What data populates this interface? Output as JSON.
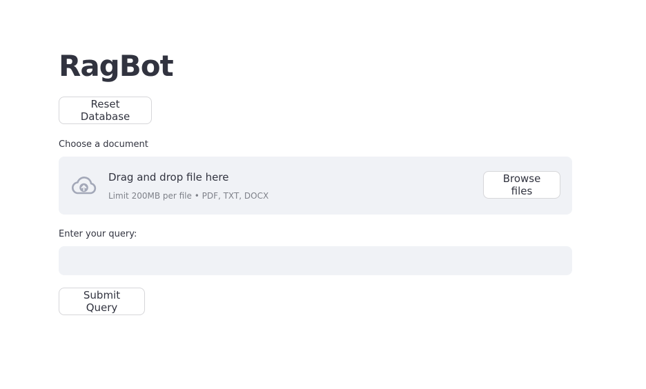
{
  "app": {
    "title": "RagBot"
  },
  "reset_button": {
    "label": "Reset Database"
  },
  "uploader": {
    "label": "Choose a document",
    "drop_text": "Drag and drop file here",
    "limit_text": "Limit 200MB per file • PDF, TXT, DOCX",
    "browse_label": "Browse files",
    "icon": "cloud-upload-icon"
  },
  "query": {
    "label": "Enter your query:",
    "value": "",
    "placeholder": ""
  },
  "submit_button": {
    "label": "Submit Query"
  },
  "colors": {
    "text": "#31333f",
    "field_bg": "#f0f2f6",
    "icon": "#a3a8b8"
  }
}
